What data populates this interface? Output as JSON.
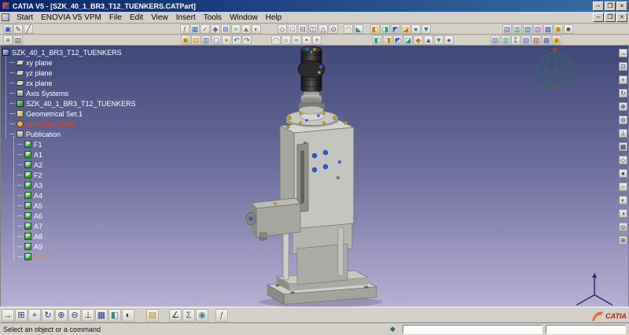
{
  "window": {
    "title": "CATIA V5 - [SZK_40_1_BR3_T12_TUENKERS.CATPart]",
    "buttons": [
      {
        "n": "minimize",
        "g": "–"
      },
      {
        "n": "maximize",
        "g": "❐"
      },
      {
        "n": "close",
        "g": "×"
      }
    ]
  },
  "menu": {
    "items": [
      "Start",
      "ENOVIA V5 VPM",
      "File",
      "Edit",
      "View",
      "Insert",
      "Tools",
      "Window",
      "Help"
    ]
  },
  "toolbar_row1": {
    "groups": [
      {
        "gap": 2,
        "icons": [
          {
            "n": "active-workbench",
            "g": "▣",
            "c": "#2f4f9e"
          },
          {
            "n": "pencil",
            "g": "✎",
            "c": "#444444"
          },
          {
            "n": "line",
            "g": "╱",
            "c": "#444444"
          }
        ]
      },
      {
        "gap": 186,
        "icons": [
          {
            "n": "formula",
            "g": "ƒ",
            "c": "#8a6d1f"
          },
          {
            "n": "design-table",
            "g": "▦",
            "c": "#3a5fae"
          },
          {
            "n": "check",
            "g": "✓",
            "c": "#2f8f2f"
          },
          {
            "n": "knowledge",
            "g": "◆",
            "c": "#7a5fae"
          },
          {
            "n": "catalog",
            "g": "⊞",
            "c": "#3a5fae"
          },
          {
            "n": "relations",
            "g": "≈",
            "c": "#2f8f8f"
          },
          {
            "n": "optimizer",
            "g": "▲",
            "c": "#b05a2a"
          },
          {
            "n": "constraints",
            "g": "◐",
            "c": "#3a5fae"
          }
        ]
      },
      {
        "gap": 20,
        "icons": [
          {
            "n": "sketch",
            "g": "◇",
            "c": "#4a4a8e"
          },
          {
            "n": "pad",
            "g": "□",
            "c": "#4a4a8e"
          },
          {
            "n": "pocket",
            "g": "⊟",
            "c": "#4a4a8e"
          },
          {
            "n": "slot",
            "g": "◫",
            "c": "#4a4a8e"
          },
          {
            "n": "rib",
            "g": "△",
            "c": "#4a4a8e"
          },
          {
            "n": "hole",
            "g": "⊙",
            "c": "#4a4a8e"
          }
        ]
      },
      {
        "gap": 6,
        "icons": [
          {
            "n": "fillet",
            "g": "◠",
            "c": "#2f8f8f"
          },
          {
            "n": "chamfer",
            "g": "◣",
            "c": "#2f8f8f"
          }
        ]
      },
      {
        "gap": 8,
        "icons": [
          {
            "n": "shaded-cube",
            "g": "◧",
            "c": "#b8860b"
          },
          {
            "n": "wire-cube",
            "g": "◨",
            "c": "#2f8f8f"
          },
          {
            "n": "half-cube",
            "g": "◩",
            "c": "#3a5fae"
          },
          {
            "n": "quarter-cube",
            "g": "◪",
            "c": "#b8860b"
          },
          {
            "n": "sphere",
            "g": "●",
            "c": "#2f8f8f"
          },
          {
            "n": "cone",
            "g": "▼",
            "c": "#3a5fae"
          }
        ]
      },
      {
        "gap": 90,
        "icons": [
          {
            "n": "translate",
            "g": "▤",
            "c": "#3a5fae"
          },
          {
            "n": "rotate-body",
            "g": "▥",
            "c": "#2f8f8f"
          },
          {
            "n": "symmetry",
            "g": "▧",
            "c": "#3a5fae"
          },
          {
            "n": "mirror",
            "g": "▨",
            "c": "#7a5fae"
          },
          {
            "n": "pattern",
            "g": "▩",
            "c": "#3a5fae"
          },
          {
            "n": "scale-body",
            "g": "▣",
            "c": "#b8860b"
          },
          {
            "n": "boolean",
            "g": "■",
            "c": "#555555"
          }
        ]
      }
    ]
  },
  "toolbar_row2": {
    "groups": [
      {
        "gap": 2,
        "icons": [
          {
            "n": "power-input",
            "g": "≡",
            "c": "#444444"
          },
          {
            "n": "tools-options",
            "g": "▤",
            "c": "#444444"
          }
        ]
      },
      {
        "gap": 200,
        "icons": [
          {
            "n": "open-catalog",
            "g": "▣",
            "c": "#b8860b"
          },
          {
            "n": "mass-library",
            "g": "▤",
            "c": "#b8860b"
          },
          {
            "n": "paste-special",
            "g": "▥",
            "c": "#3a5fae"
          },
          {
            "n": "copy",
            "g": "▢",
            "c": "#3a5fae"
          },
          {
            "n": "cut",
            "g": "×",
            "c": "#8a3a3a"
          },
          {
            "n": "undo",
            "g": "↶",
            "c": "#2f4f9e"
          },
          {
            "n": "redo",
            "g": "↷",
            "c": "#2f4f9e"
          }
        ]
      },
      {
        "gap": 24,
        "icons": [
          {
            "n": "profile",
            "g": "◠",
            "c": "#4a4a8e"
          },
          {
            "n": "circle",
            "g": "○",
            "c": "#4a4a8e"
          },
          {
            "n": "spline",
            "g": "≈",
            "c": "#4a4a8e"
          },
          {
            "n": "point",
            "g": "•",
            "c": "#4a4a8e"
          },
          {
            "n": "axis",
            "g": "+",
            "c": "#4a4a8e"
          }
        ]
      },
      {
        "gap": 64,
        "icons": [
          {
            "n": "shading",
            "g": "◧",
            "c": "#2f8f8f"
          },
          {
            "n": "shading-edges",
            "g": "◨",
            "c": "#b8860b"
          },
          {
            "n": "wireframe",
            "g": "◩",
            "c": "#3a5fae"
          },
          {
            "n": "hidden-line",
            "g": "◪",
            "c": "#2f8f8f"
          },
          {
            "n": "iso-view",
            "g": "◆",
            "c": "#b8860b"
          },
          {
            "n": "front-view",
            "g": "▲",
            "c": "#3a5fae"
          },
          {
            "n": "top-view",
            "g": "▼",
            "c": "#2f8f8f"
          },
          {
            "n": "side-view",
            "g": "●",
            "c": "#3a5fae"
          }
        ]
      },
      {
        "gap": 46,
        "icons": [
          {
            "n": "measure-between",
            "g": "▤",
            "c": "#3a5fae"
          },
          {
            "n": "measure-item",
            "g": "▥",
            "c": "#2f8f8f"
          },
          {
            "n": "mass-properties",
            "g": "Σ",
            "c": "#555555"
          },
          {
            "n": "section",
            "g": "▧",
            "c": "#3a5fae"
          },
          {
            "n": "clash",
            "g": "▨",
            "c": "#8a3a3a"
          },
          {
            "n": "distance",
            "g": "▩",
            "c": "#3a5fae"
          },
          {
            "n": "annotation",
            "g": "▣",
            "c": "#b8860b"
          }
        ]
      }
    ]
  },
  "tree": {
    "root": {
      "label": "SZK_40_1_BR3_T12_TUENKERS",
      "icon": "part-icon"
    },
    "children": [
      {
        "label": "xy plane",
        "icon": "plane-icon"
      },
      {
        "label": "yz plane",
        "icon": "plane-icon"
      },
      {
        "label": "zx plane",
        "icon": "plane-icon"
      },
      {
        "label": "Axis Systems",
        "icon": "axis-systems-icon"
      },
      {
        "label": "SZK_40_1_BR3_T12_TUENKERS",
        "icon": "partbody-icon"
      },
      {
        "label": "Geometrical Set.1",
        "icon": "geometrical-set-icon"
      },
      {
        "label": "MISCHDICHTE",
        "icon": "parameter-icon",
        "color": "#e04828"
      },
      {
        "label": "Publication",
        "icon": "publication-icon"
      }
    ],
    "pub_badge": "P",
    "publications": [
      {
        "label": "F1"
      },
      {
        "label": "A1"
      },
      {
        "label": "A2"
      },
      {
        "label": "F2"
      },
      {
        "label": "A3"
      },
      {
        "label": "A4"
      },
      {
        "label": "A5"
      },
      {
        "label": "A6"
      },
      {
        "label": "A7"
      },
      {
        "label": "A8"
      },
      {
        "label": "A9"
      },
      {
        "label": "A10",
        "color": "#f0862c"
      }
    ]
  },
  "right_toolbar": {
    "icons": [
      {
        "n": "fly",
        "g": "→"
      },
      {
        "n": "fit-all",
        "g": "⊡"
      },
      {
        "n": "pan",
        "g": "+"
      },
      {
        "n": "rotate",
        "g": "↻"
      },
      {
        "n": "zoom-in",
        "g": "⊕"
      },
      {
        "n": "zoom-out",
        "g": "⊖"
      },
      {
        "n": "normal-view",
        "g": "⊥"
      },
      {
        "n": "multi-view",
        "g": "▦"
      },
      {
        "n": "iso-view",
        "g": "◇"
      },
      {
        "n": "shading-mode",
        "g": "●"
      },
      {
        "n": "wireframe-mode",
        "g": "○"
      },
      {
        "n": "hide-show",
        "g": "◐"
      },
      {
        "n": "swap-visible",
        "g": "◑"
      },
      {
        "n": "magnifier",
        "g": "◎"
      },
      {
        "n": "full-screen",
        "g": "⊞"
      }
    ]
  },
  "bottom_toolbar": {
    "groups": [
      {
        "gap": 0,
        "icons": [
          {
            "n": "fly-mode",
            "g": "→",
            "c": "#223a7e"
          },
          {
            "n": "fit-all",
            "g": "⊞",
            "c": "#223a7e"
          },
          {
            "n": "pan",
            "g": "+",
            "c": "#223a7e"
          },
          {
            "n": "rotate",
            "g": "↻",
            "c": "#223a7e"
          },
          {
            "n": "zoom-in",
            "g": "⊕",
            "c": "#223a7e"
          },
          {
            "n": "zoom-out",
            "g": "⊖",
            "c": "#223a7e"
          },
          {
            "n": "normal-view",
            "g": "⊥",
            "c": "#223a7e"
          },
          {
            "n": "multi-view",
            "g": "▦",
            "c": "#223a7e"
          },
          {
            "n": "quick-shading",
            "g": "◧",
            "c": "#2f8f8f"
          },
          {
            "n": "hide-show",
            "g": "◐",
            "c": "#223a7e"
          }
        ]
      },
      {
        "gap": 14,
        "icons": [
          {
            "n": "catalog-browser",
            "g": "▤",
            "c": "#b8860b"
          }
        ]
      },
      {
        "gap": 12,
        "icons": [
          {
            "n": "measure",
            "g": "∠",
            "c": "#223a7e"
          },
          {
            "n": "mass",
            "g": "Σ",
            "c": "#555555"
          },
          {
            "n": "material",
            "g": "◉",
            "c": "#2f8f8f"
          }
        ]
      },
      {
        "gap": 8,
        "icons": [
          {
            "n": "knowledge-formula",
            "g": "ƒ",
            "c": "#8a6d1f"
          }
        ]
      }
    ],
    "logo_text": "CATIA"
  },
  "statusbar": {
    "message": "Select an object or a command",
    "field1": "",
    "field2": ""
  }
}
